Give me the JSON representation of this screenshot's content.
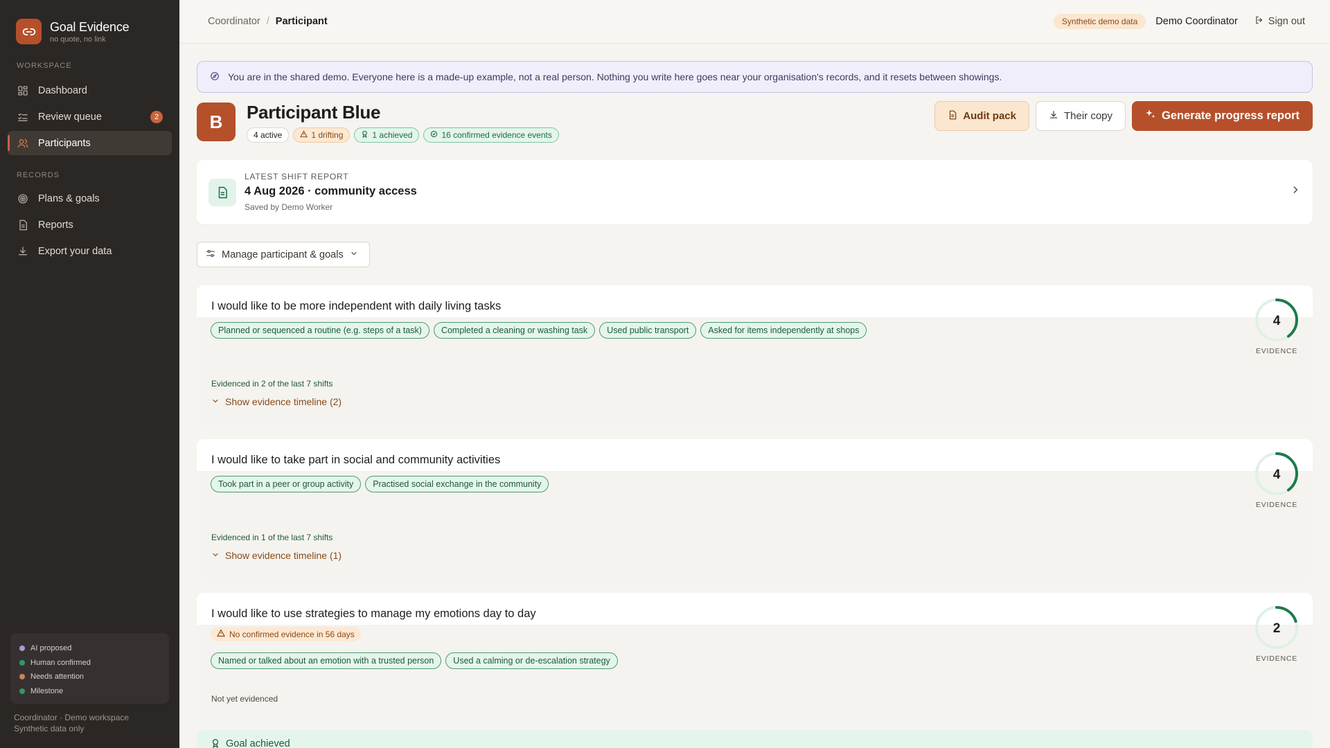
{
  "brand": {
    "title": "Goal Evidence",
    "subtitle": "no quote, no link"
  },
  "sidebar": {
    "workspace_label": "WORKSPACE",
    "records_label": "RECORDS",
    "items": [
      {
        "label": "Dashboard",
        "icon": "dashboard-icon"
      },
      {
        "label": "Review queue",
        "icon": "list-check-icon",
        "badge": "2"
      },
      {
        "label": "Participants",
        "icon": "users-icon",
        "active": true
      },
      {
        "label": "Plans & goals",
        "icon": "target-icon"
      },
      {
        "label": "Reports",
        "icon": "document-icon"
      },
      {
        "label": "Export your data",
        "icon": "download-icon"
      }
    ],
    "legend": [
      {
        "label": "AI proposed",
        "color": "#a79bd0"
      },
      {
        "label": "Human confirmed",
        "color": "#2f9a62"
      },
      {
        "label": "Needs attention",
        "color": "#c8865a"
      },
      {
        "label": "Milestone",
        "color": "#2f9a62"
      }
    ],
    "footer_line1": "Coordinator · Demo workspace",
    "footer_line2": "Synthetic data only"
  },
  "topbar": {
    "crumb_root": "Coordinator",
    "crumb_sep": "/",
    "crumb_current": "Participant",
    "demo_pill": "Synthetic demo data",
    "user": "Demo Coordinator",
    "signout": "Sign out"
  },
  "banner": "You are in the shared demo. Everyone here is a made-up example, not a real person. Nothing you write here goes near your organisation's records, and it resets between showings.",
  "participant": {
    "initial": "B",
    "name": "Participant Blue",
    "tags": {
      "active": "4 active",
      "drifting": "1 drifting",
      "achieved": "1 achieved",
      "events": "16 confirmed evidence events"
    }
  },
  "actions": {
    "audit": "Audit pack",
    "copy": "Their copy",
    "generate": "Generate progress report"
  },
  "report": {
    "kicker": "LATEST SHIFT REPORT",
    "title": "4 Aug 2026 · community access",
    "saved_by": "Saved by Demo Worker"
  },
  "manage_label": "Manage participant & goals",
  "goals": [
    {
      "title": "I would like to be more independent with daily living tasks",
      "chips": [
        "Planned or sequenced a routine (e.g. steps of a task)",
        "Completed a cleaning or washing task",
        "Used public transport",
        "Asked for items independently at shops"
      ],
      "evidenced": "Evidenced in 2 of the last 7 shifts",
      "timeline": "Show evidence timeline (2)",
      "count": "4",
      "ring_fill": 0.4,
      "ring_label": "EVIDENCE"
    },
    {
      "title": "I would like to take part in social and community activities",
      "chips": [
        "Took part in a peer or group activity",
        "Practised social exchange in the community"
      ],
      "evidenced": "Evidenced in 1 of the last 7 shifts",
      "timeline": "Show evidence timeline (1)",
      "count": "4",
      "ring_fill": 0.4,
      "ring_label": "EVIDENCE"
    },
    {
      "title": "I would like to use strategies to manage my emotions day to day",
      "warning": "No confirmed evidence in 56 days",
      "chips": [
        "Named or talked about an emotion with a trusted person",
        "Used a calming or de-escalation strategy"
      ],
      "status": "Not yet evidenced",
      "count": "2",
      "ring_fill": 0.2,
      "ring_label": "EVIDENCE"
    }
  ],
  "achieved_label": "Goal achieved",
  "colors": {
    "accent": "#b5502b",
    "success": "#1f7a4d",
    "sidebar_bg": "#2b2724"
  }
}
